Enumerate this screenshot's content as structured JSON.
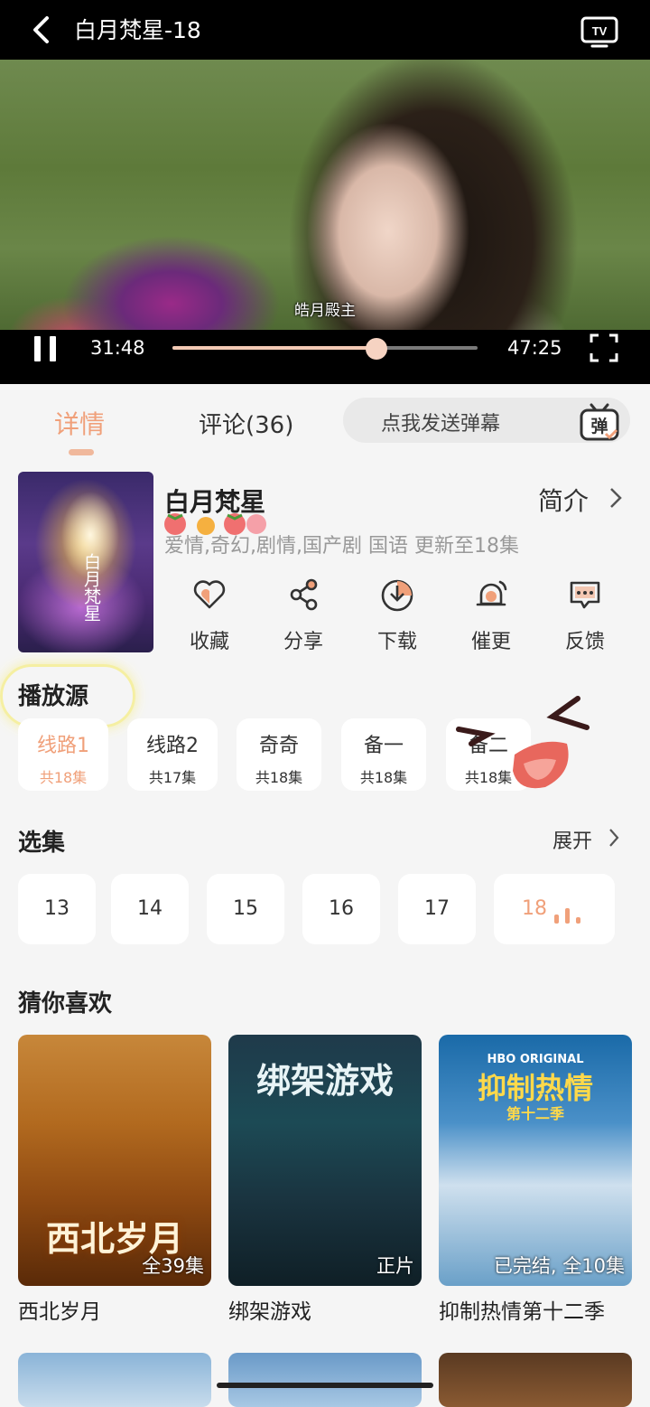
{
  "header": {
    "title": "白月梵星-18"
  },
  "player": {
    "subtitle": "皓月殿主",
    "current_time": "31:48",
    "duration": "47:25",
    "progress": 0.67
  },
  "tabs": {
    "details": "详情",
    "comments": "评论(36)"
  },
  "danmaku": {
    "placeholder": "点我发送弹幕",
    "icon_label": "弹"
  },
  "show": {
    "poster_title": "白月梵星",
    "name": "白月梵星",
    "intro": "简介",
    "tags": "爱情,奇幻,剧情,国产剧 国语 更新至18集"
  },
  "actions": [
    {
      "label": "收藏",
      "icon": "heart-icon"
    },
    {
      "label": "分享",
      "icon": "share-icon"
    },
    {
      "label": "下载",
      "icon": "download-icon"
    },
    {
      "label": "催更",
      "icon": "bell-icon"
    },
    {
      "label": "反馈",
      "icon": "feedback-icon"
    }
  ],
  "sources": {
    "heading": "播放源",
    "items": [
      {
        "name": "线路1",
        "count": "共18集"
      },
      {
        "name": "线路2",
        "count": "共17集"
      },
      {
        "name": "奇奇",
        "count": "共18集"
      },
      {
        "name": "备一",
        "count": "共18集"
      },
      {
        "name": "备二",
        "count": "共18集"
      }
    ]
  },
  "episodes": {
    "heading": "选集",
    "expand": "展开",
    "items": [
      "13",
      "14",
      "15",
      "16",
      "17",
      "18"
    ]
  },
  "recommend": {
    "heading": "猜你喜欢",
    "items": [
      {
        "title": "西北岁月",
        "badge": "全39集",
        "cover_text": "西北岁月"
      },
      {
        "title": "绑架游戏",
        "badge": "正片",
        "cover_text": "绑架游戏"
      },
      {
        "title": "抑制热情第十二季",
        "badge": "已完结, 全10集",
        "cover_text": "抑制热情",
        "cover_sub": "第十二季",
        "cover_brand": "HBO ORIGINAL"
      }
    ]
  },
  "colors": {
    "accent": "#f0a07a",
    "background": "#f5f5f5"
  }
}
